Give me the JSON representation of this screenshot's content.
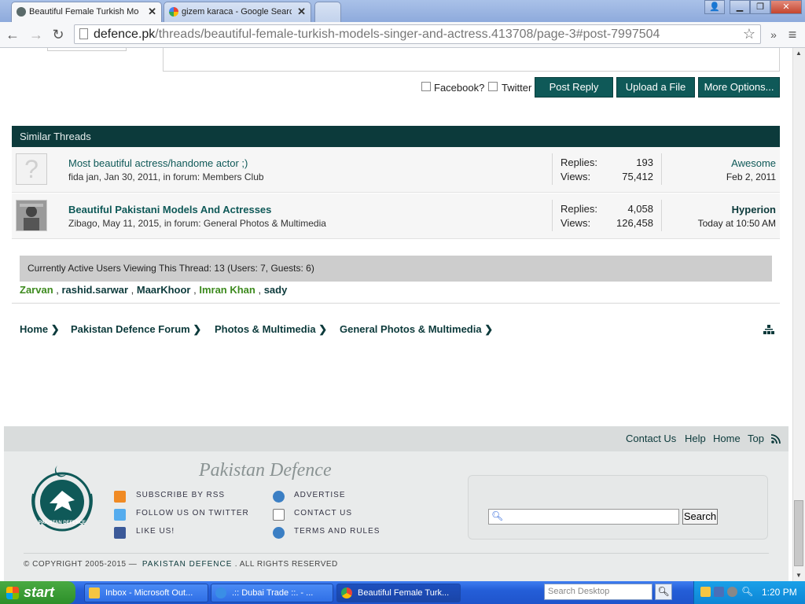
{
  "browser": {
    "tabs": [
      {
        "title": "Beautiful Female Turkish Mod",
        "active": true
      },
      {
        "title": "gizem karaca - Google Search",
        "active": false
      }
    ],
    "url_host": "defence.pk",
    "url_path": "/threads/beautiful-female-turkish-models-singer-and-actress.413708/page-3#post-7997504"
  },
  "reply": {
    "facebook_label": "Facebook?",
    "twitter_label": "Twitter",
    "post_reply": "Post Reply",
    "upload": "Upload a File",
    "more": "More Options..."
  },
  "similar_threads": {
    "heading": "Similar Threads",
    "replies_label": "Replies:",
    "views_label": "Views:",
    "threads": [
      {
        "title": "Most beautiful actress/handome actor ;)",
        "meta": "fida jan, Jan 30, 2011, in forum: Members Club",
        "replies": "193",
        "views": "75,412",
        "last_poster": "Awesome",
        "last_date": "Feb 2, 2011"
      },
      {
        "title": "Beautiful Pakistani Models And Actresses",
        "meta": "Zibago, May 11, 2015, in forum: General Photos & Multimedia",
        "replies": "4,058",
        "views": "126,458",
        "last_poster": "Hyperion",
        "last_date": "Today at 10:50 AM"
      }
    ]
  },
  "viewers": {
    "text": "Currently Active Users Viewing This Thread: 13 (Users: 7, Guests: 6)",
    "users": [
      "Zarvan",
      "rashid.sarwar",
      "MaarKhoor",
      "Imran Khan",
      "sady"
    ]
  },
  "breadcrumb": [
    "Home",
    "Pakistan Defence Forum",
    "Photos & Multimedia",
    "General Photos & Multimedia"
  ],
  "footer_links": [
    "Contact Us",
    "Help",
    "Home",
    "Top"
  ],
  "footer": {
    "site_title": "Pakistan Defence",
    "left_items": [
      "SUBSCRIBE BY RSS",
      "FOLLOW US ON TWITTER",
      "LIKE US!"
    ],
    "right_items": [
      "ADVERTISE",
      "CONTACT US",
      "TERMS AND RULES"
    ],
    "search_button": "Search",
    "copyright_prefix": "© COPYRIGHT 2005-2015 —",
    "copyright_brand": "PAKISTAN DEFENCE",
    "copyright_suffix": ". ALL RIGHTS RESERVED",
    "logo_text": "PAKISTAN DEFENCE"
  },
  "taskbar": {
    "start": "start",
    "tasks": [
      "Inbox - Microsoft Out...",
      ".:: Dubai Trade ::. - ...",
      "Beautiful Female Turk..."
    ],
    "search_placeholder": "Search Desktop",
    "clock": "1:20 PM"
  },
  "colors": {
    "brand_dark": "#0c3a3b",
    "brand_green": "#0f5958",
    "user_green": "#3d8a1e"
  }
}
